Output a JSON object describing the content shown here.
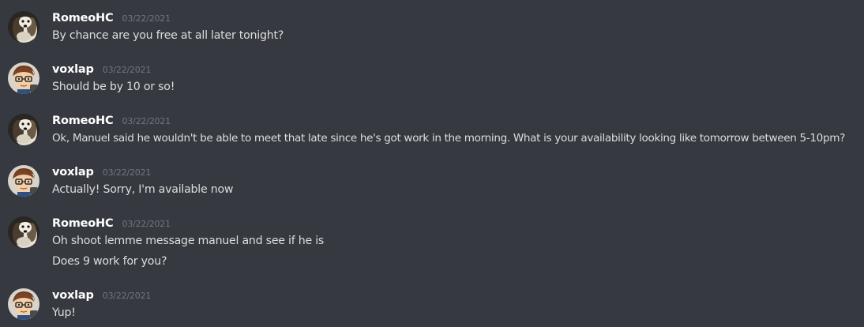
{
  "colors": {
    "background": "#36393f",
    "username": "#ffffff",
    "timestamp": "#72767d",
    "message_text": "#dcddde"
  },
  "messages": [
    {
      "author": "RomeoHC",
      "avatar_icon": "dog-avatar-icon",
      "timestamp": "03/22/2021",
      "lines": [
        "By chance are you free at all later tonight?"
      ]
    },
    {
      "author": "voxlap",
      "avatar_icon": "cartoon-glasses-avatar-icon",
      "timestamp": "03/22/2021",
      "lines": [
        "Should be by 10 or so!"
      ]
    },
    {
      "author": "RomeoHC",
      "avatar_icon": "dog-avatar-icon",
      "timestamp": "03/22/2021",
      "lines": [
        "Ok, Manuel said he wouldn't be able to meet that late since he's got work in the morning. What is your availability looking like tomorrow between 5-10pm?"
      ]
    },
    {
      "author": "voxlap",
      "avatar_icon": "cartoon-glasses-avatar-icon",
      "timestamp": "03/22/2021",
      "lines": [
        "Actually! Sorry, I'm available now"
      ]
    },
    {
      "author": "RomeoHC",
      "avatar_icon": "dog-avatar-icon",
      "timestamp": "03/22/2021",
      "lines": [
        "Oh shoot lemme message manuel and see if he is",
        "Does 9 work for you?"
      ]
    },
    {
      "author": "voxlap",
      "avatar_icon": "cartoon-glasses-avatar-icon",
      "timestamp": "03/22/2021",
      "lines": [
        "Yup!"
      ]
    }
  ]
}
